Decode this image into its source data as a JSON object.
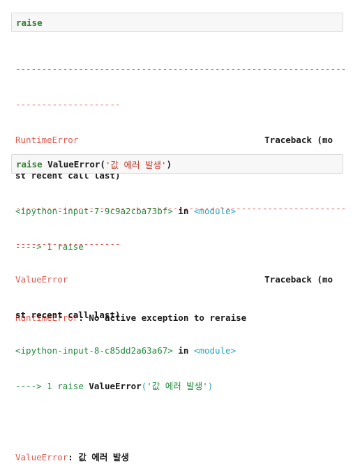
{
  "cell1": {
    "input_keyword": "raise",
    "output": {
      "sep_long": "---------------------------------------------------------------",
      "sep_short": "--------------------",
      "error_name": "RuntimeError",
      "traceback_label": "Traceback (mo",
      "traceback_cont": "st recent call last)",
      "ipython_input": "<ipython-input-7-9c9a2cba73bf>",
      "in_text": " in ",
      "module_text": "<module>",
      "arrow_line": "----> 1 raise",
      "error_msg_name": "RuntimeError",
      "error_msg_sep": ": ",
      "error_msg_text": "No active exception to reraise"
    }
  },
  "cell2": {
    "input_keyword": "raise",
    "input_rest_1": " ValueError(",
    "input_string": "'값 에러 발생'",
    "input_rest_2": ")",
    "output": {
      "sep_long": "---------------------------------------------------------------",
      "sep_short": "--------------------",
      "error_name": "ValueError",
      "traceback_label": "Traceback (mo",
      "traceback_cont": "st recent call last)",
      "ipython_input": "<ipython-input-8-c85dd2a63a67>",
      "in_text": " in ",
      "module_text": "<module>",
      "arrow_prefix": "----> 1 ",
      "arrow_code_kw": "raise",
      "arrow_code_rest": " ValueError",
      "arrow_paren_open": "(",
      "arrow_string": "'값 에러 발생'",
      "arrow_paren_close": ")",
      "error_msg_name": "ValueError",
      "error_msg_sep": ": ",
      "error_msg_text": "값 에러 발생"
    }
  }
}
